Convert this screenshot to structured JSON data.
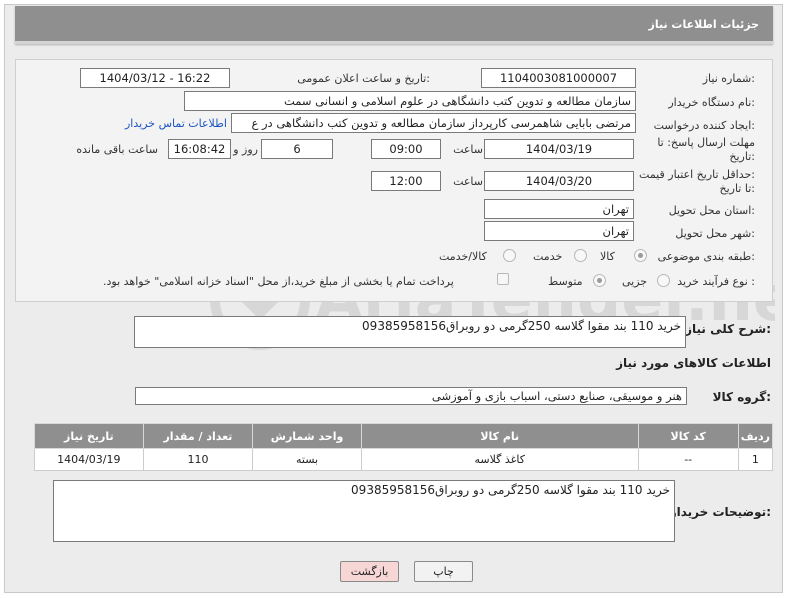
{
  "header": {
    "title": "جزئیات اطلاعات نیاز"
  },
  "form": {
    "need_number_label": "شماره نیاز:",
    "need_number": "1104003081000007",
    "announce_label": "تاریخ و ساعت اعلان عمومی:",
    "announce_value": "1404/03/12 - 16:22",
    "buyer_org_label": "نام دستگاه خریدار:",
    "buyer_org": "سازمان مطالعه و تدوین کتب دانشگاهی در علوم اسلامی و انسانی سمت",
    "requester_label": "ایجاد کننده درخواست:",
    "requester": "مرتضی بابایی شاهمرسی کارپرداز سازمان مطالعه و تدوین کتب دانشگاهی در ع",
    "contact_link": "اطلاعات تماس خریدار",
    "reply_deadline_label_1": "مهلت ارسال پاسخ: تا",
    "reply_deadline_label_2": "تاریخ:",
    "reply_date": "1404/03/19",
    "time_label": "ساعت",
    "reply_time": "09:00",
    "days_count": "6",
    "days_label": "روز و",
    "remaining_time": "16:08:42",
    "remaining_label": "ساعت باقی مانده",
    "price_validity_label_1": "حداقل تاریخ اعتبار قیمت:",
    "price_validity_label_2": "تا تاریخ:",
    "price_date": "1404/03/20",
    "price_time": "12:00",
    "province_label": "استان محل تحویل:",
    "province": "تهران",
    "city_label": "شهر محل تحویل:",
    "city": "تهران",
    "category_label": "طبقه بندی موضوعی:",
    "category_options": [
      "کالا",
      "خدمت",
      "کالا/خدمت"
    ],
    "process_label": "نوع فرآیند خرید :",
    "process_options": [
      "جزیی",
      "متوسط"
    ],
    "payment_note": "پرداخت تمام یا بخشی از مبلغ خرید،از محل \"اسناد خزانه اسلامی\" خواهد بود."
  },
  "summary": {
    "label": "شرح کلی نیاز:",
    "text": "خرید 110 بند مقوا گلاسه 250گرمی دو روبراق09385958156"
  },
  "goods": {
    "section_title": "اطلاعات کالاهای مورد نیاز",
    "group_label": "گروه کالا:",
    "group_value": "هنر و موسیقی، صنایع دستی، اسباب بازی و آموزشی",
    "columns": [
      "ردیف",
      "کد کالا",
      "نام کالا",
      "واحد شمارش",
      "تعداد / مقدار",
      "تاریخ نیاز"
    ],
    "rows": [
      [
        "1",
        "--",
        "کاغذ گلاسه",
        "بسته",
        "110",
        "1404/03/19"
      ]
    ]
  },
  "buyer_notes": {
    "label": "توضیحات خریدار:",
    "text": "خرید 110 بند مقوا گلاسه 250گرمی دو روبراق09385958156"
  },
  "actions": {
    "print": "چاپ",
    "back": "بازگشت"
  },
  "watermark_text": "AriaTender.neT",
  "colors": {
    "header_bg": "#8f8f8f",
    "link": "#1a55c2",
    "back_button_bg": "#f7d6d6",
    "print_button_bg": "#f2f2f2"
  }
}
